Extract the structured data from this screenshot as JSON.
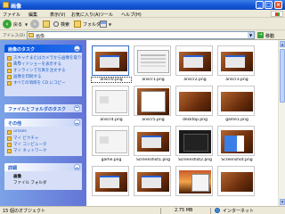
{
  "window": {
    "title": "画像"
  },
  "menu": [
    "ファイル",
    "編集",
    "表示(V)",
    "お気に入り(A)",
    "ツール",
    "ヘルプ(H)"
  ],
  "toolbar": {
    "back": "戻る",
    "search": "検索",
    "folders": "フォルダ"
  },
  "address": {
    "label": "アドレス(D)",
    "path": "画像",
    "go": "移動"
  },
  "taskpane": {
    "panels": [
      {
        "title": "画像のタスク",
        "items": [
          "スキャナまたはカメラから画像を取り込む",
          "スライドショーを表示する",
          "オンラインで写真を注文する",
          "画像を印刷する",
          "すべての項目を CD にコピー"
        ]
      },
      {
        "title": "ファイルとフォルダのタスク",
        "items": []
      },
      {
        "title": "その他",
        "items": [
          "ursoos",
          "マイ ピクチャ",
          "マイ コンピュータ",
          "マイ ネットワーク"
        ]
      },
      {
        "title": "詳細",
        "items": [
          "画像",
          "ファイル フォルダ"
        ]
      }
    ]
  },
  "files": [
    {
      "name": "anscr0.png",
      "selected": true
    },
    {
      "name": "anscr1.png"
    },
    {
      "name": "anscr2.png"
    },
    {
      "name": "anscr3.png"
    },
    {
      "name": "anscr4.png"
    },
    {
      "name": "anscr5.png"
    },
    {
      "name": "desktop.png"
    },
    {
      "name": "game1.png"
    },
    {
      "name": "game.png"
    },
    {
      "name": "Screenshot1.png"
    },
    {
      "name": "Screenshot2.png"
    },
    {
      "name": "Screenshot.png"
    },
    {
      "name": ""
    },
    {
      "name": ""
    },
    {
      "name": ""
    },
    {
      "name": ""
    }
  ],
  "status": {
    "count": "15 個のオブジェクト",
    "size": "2.75 MB",
    "zone": "インターネット"
  }
}
